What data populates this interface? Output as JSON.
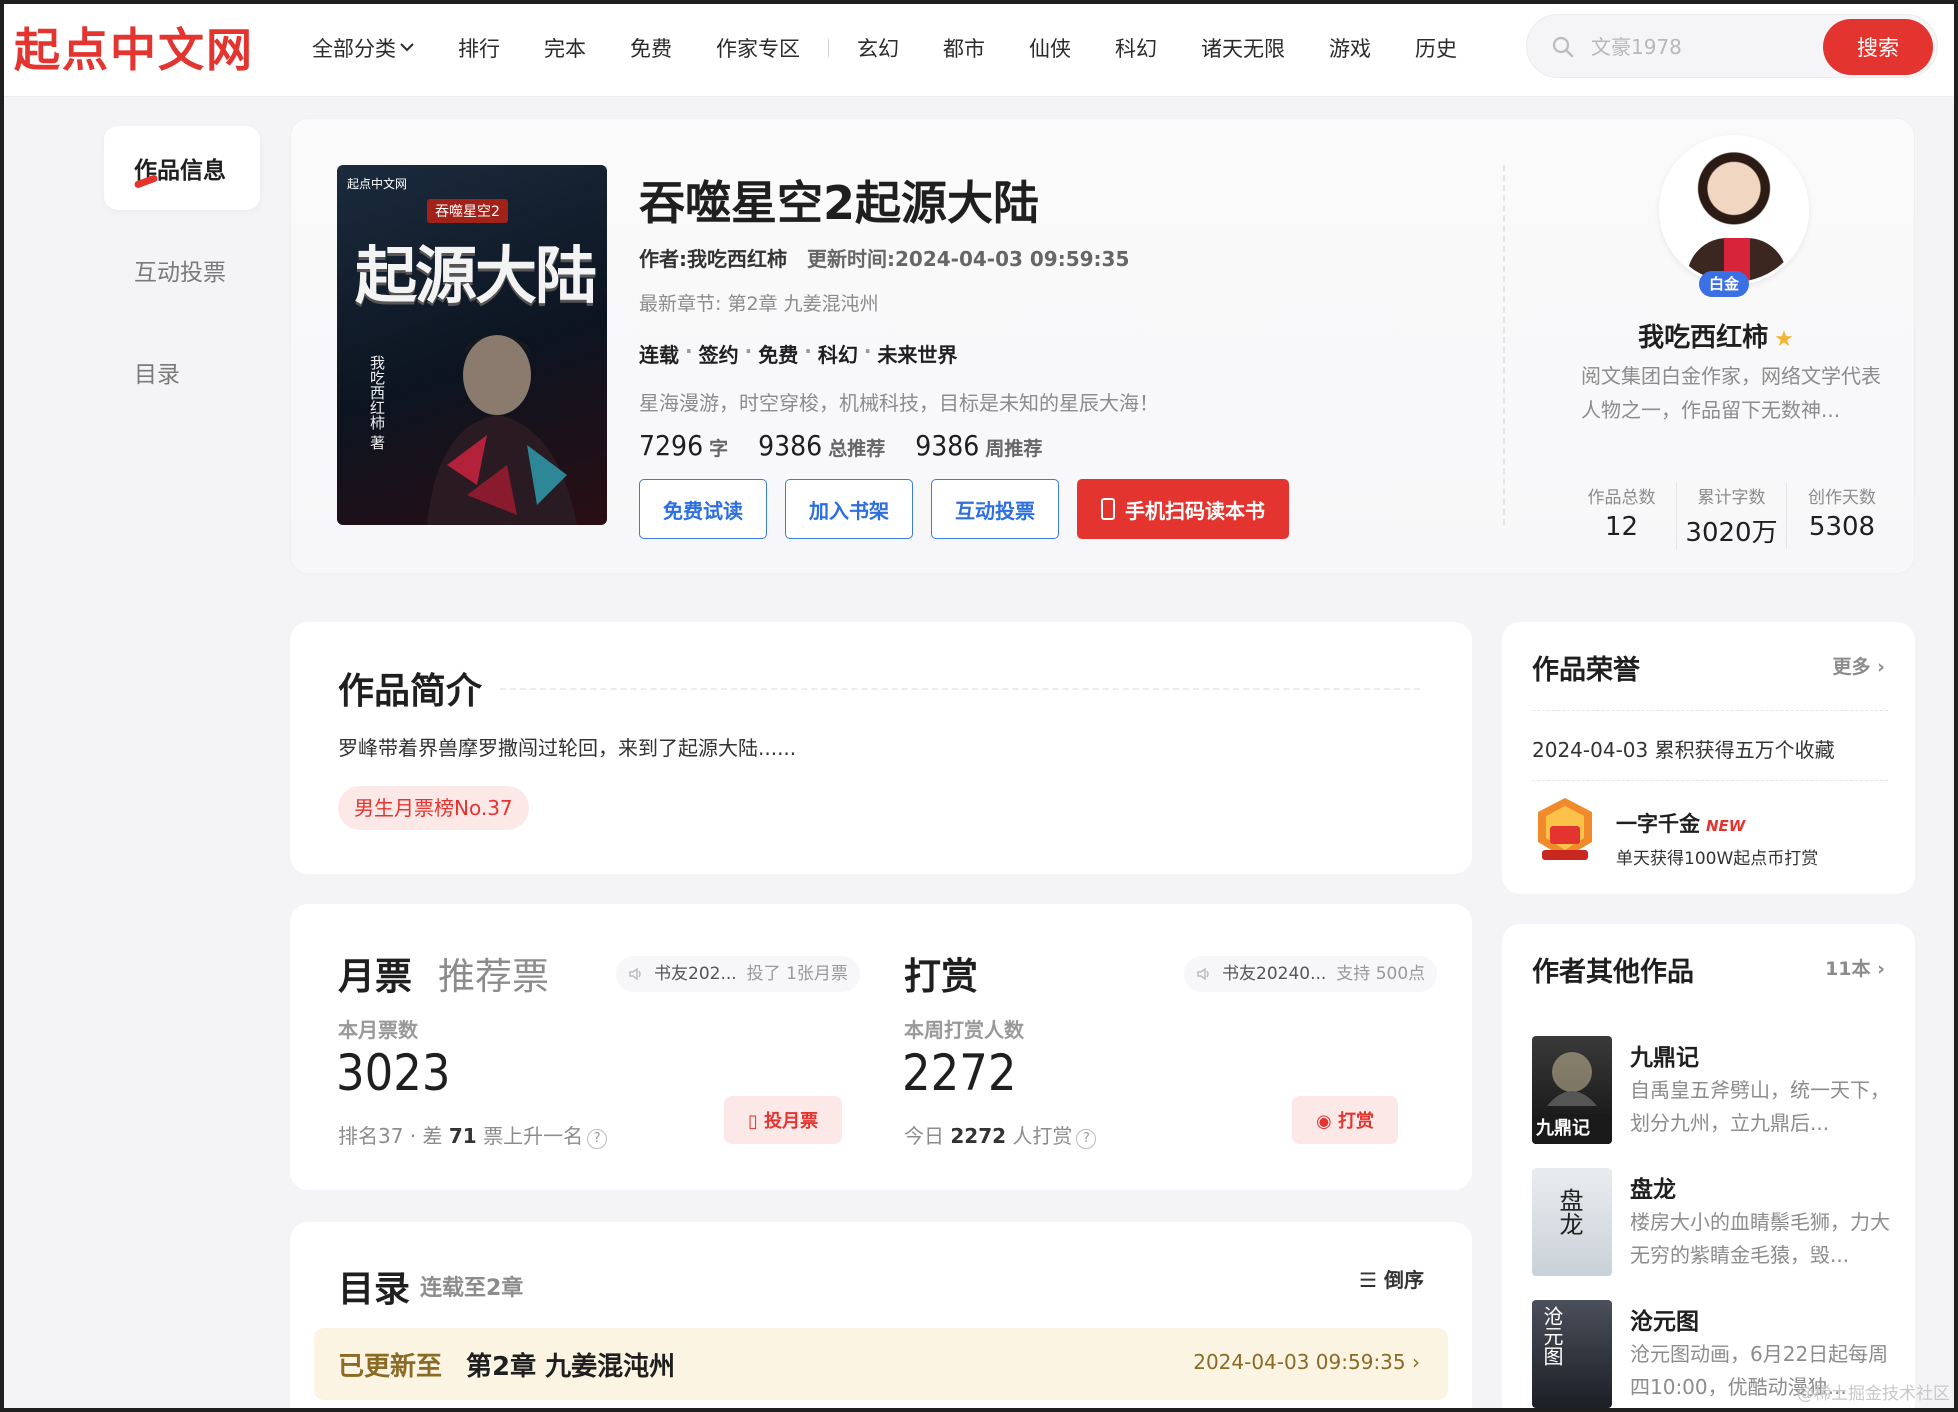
{
  "header": {
    "logo": "起点中文网",
    "nav": [
      {
        "label": "全部分类",
        "has_chevron": true
      },
      {
        "label": "排行"
      },
      {
        "label": "完本"
      },
      {
        "label": "免费"
      },
      {
        "label": "作家专区"
      }
    ],
    "nav_genres": [
      "玄幻",
      "都市",
      "仙侠",
      "科幻",
      "诸天无限",
      "游戏",
      "历史"
    ],
    "search": {
      "placeholder": "文豪1978",
      "button": "搜索",
      "icon": "search-icon"
    }
  },
  "side_nav": {
    "items": [
      {
        "label": "作品信息",
        "active": true
      },
      {
        "label": "互动投票",
        "active": false
      },
      {
        "label": "目录",
        "active": false
      }
    ]
  },
  "book": {
    "cover": {
      "publisher": "起点中文网",
      "subtitle": "吞噬星空2",
      "title": "起源大陆",
      "author_vertical": "我吃西红柿 著"
    },
    "title": "吞噬星空2起源大陆",
    "author_line": "作者:我吃西红柿",
    "updated_line": "更新时间:2024-04-03 09:59:35",
    "latest_chapter": "最新章节: 第2章 九姜混沌州",
    "tags": [
      "连载",
      "签约",
      "免费",
      "科幻",
      "未来世界"
    ],
    "intro_line": "星海漫游，时空穿梭，机械科技，目标是未知的星辰大海！",
    "stats": [
      {
        "num": "7296",
        "unit": "字"
      },
      {
        "num": "9386",
        "unit": "总推荐"
      },
      {
        "num": "9386",
        "unit": "周推荐"
      }
    ],
    "buttons": {
      "free_read": "免费试读",
      "add_shelf": "加入书架",
      "vote": "互动投票",
      "scan": "手机扫码读本书"
    },
    "accent_color": "#e4342f"
  },
  "author": {
    "badge": "白金",
    "name": "我吃西红柿",
    "desc": "阅文集团白金作家，网络文学代表人物之一，作品留下无数神...",
    "stats": [
      {
        "label": "作品总数",
        "value": "12"
      },
      {
        "label": "累计字数",
        "value": "3020万"
      },
      {
        "label": "创作天数",
        "value": "5308"
      }
    ]
  },
  "intro": {
    "title": "作品简介",
    "text": "罗峰带着界兽摩罗撒闯过轮回，来到了起源大陆......",
    "rank_badge": "男生月票榜No.37"
  },
  "votes": {
    "monthly": {
      "title": "月票",
      "alt_title": "推荐票",
      "ticker_user": "书友202...",
      "ticker_action": "投了 1张月票",
      "label": "本月票数",
      "count": "3023",
      "rank_prefix": "排名37 · 差",
      "rank_gap": "71",
      "rank_suffix": "票上升一名",
      "button": "投月票"
    },
    "reward": {
      "title": "打赏",
      "ticker_user": "书友20240...",
      "ticker_action": "支持 500点",
      "label": "本周打赏人数",
      "count": "2272",
      "today_prefix": "今日",
      "today_count": "2272",
      "today_suffix": "人打赏",
      "button": "打赏"
    }
  },
  "toc": {
    "title": "目录",
    "subtitle": "连载至2章",
    "sort": "倒序",
    "latest_label": "已更新至",
    "latest_chapter": "第2章 九姜混沌州",
    "latest_time": "2024-04-03 09:59:35"
  },
  "honor": {
    "title": "作品荣誉",
    "more": "更多",
    "line": "2024-04-03 累积获得五万个收藏",
    "medal_name": "一字千金",
    "medal_new": "NEW",
    "medal_desc": "单天获得100W起点币打赏"
  },
  "other_works": {
    "title": "作者其他作品",
    "count": "11本",
    "items": [
      {
        "name": "九鼎记",
        "desc": "自禹皇五斧劈山，统一天下，划分九州，立九鼎后...",
        "cover_text": "九鼎记"
      },
      {
        "name": "盘龙",
        "desc": "楼房大小的血睛鬃毛狮，力大无穷的紫睛金毛猿，毁...",
        "cover_text": "盘龙"
      },
      {
        "name": "沧元图",
        "desc": "沧元图动画，6月22日起每周四10:00，优酷动漫独...",
        "cover_text": "沧元图"
      }
    ]
  },
  "watermark": "@稀土掘金技术社区"
}
